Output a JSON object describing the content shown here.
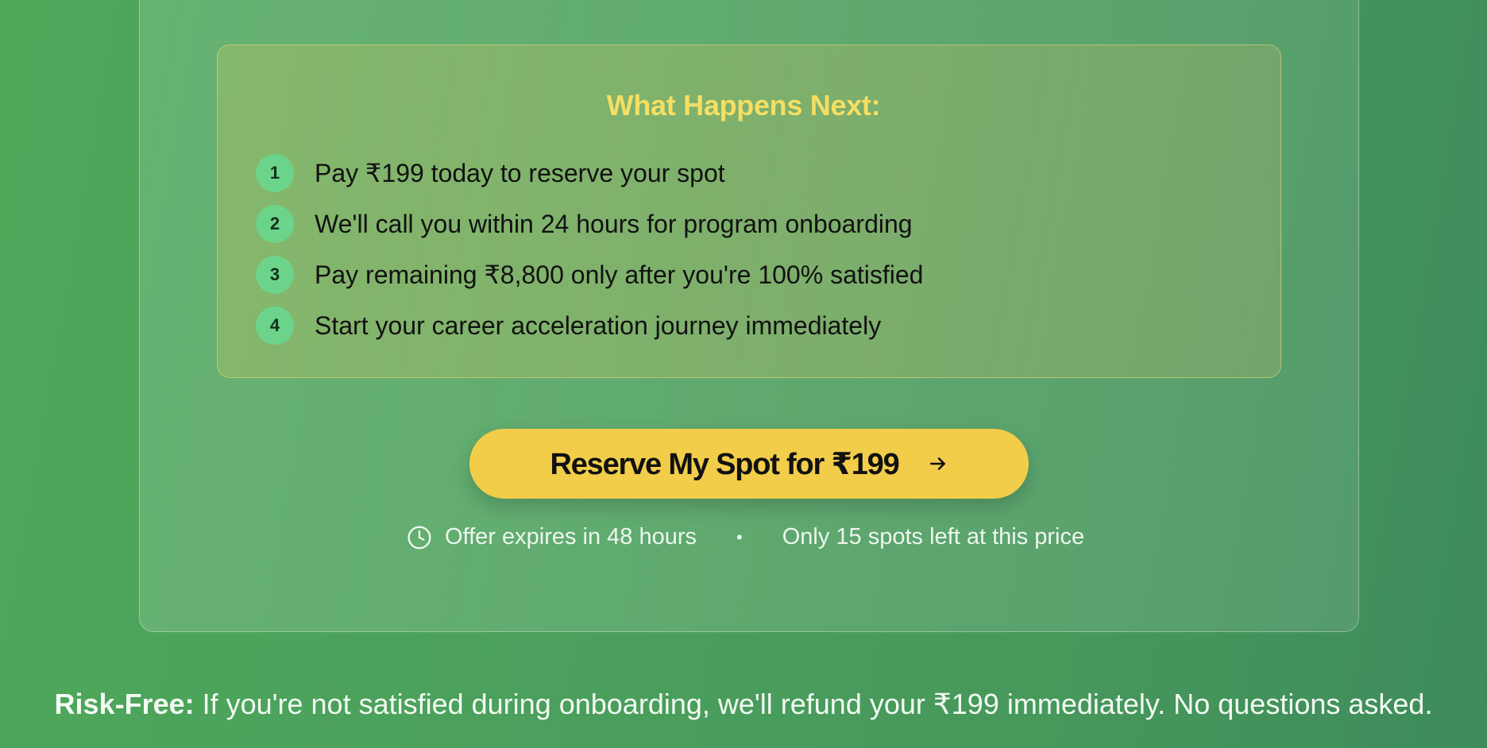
{
  "next": {
    "title": "What Happens Next:",
    "steps": [
      {
        "num": "1",
        "text": "Pay ₹199 today to reserve your spot"
      },
      {
        "num": "2",
        "text": "We'll call you within 24 hours for program onboarding"
      },
      {
        "num": "3",
        "text": "Pay remaining ₹8,800 only after you're 100% satisfied"
      },
      {
        "num": "4",
        "text": "Start your career acceleration journey immediately"
      }
    ]
  },
  "cta": {
    "label": "Reserve My Spot for ₹199"
  },
  "meta": {
    "expiry": "Offer expires in 48 hours",
    "separator": "•",
    "spots": "Only 15 spots left at this price"
  },
  "footer": {
    "label": "Risk-Free:",
    "text": " If you're not satisfied during onboarding, we'll refund your ₹199 immediately. No questions asked."
  },
  "colors": {
    "accent": "#f2cd4a",
    "title": "#f5df63",
    "step_badge": "#6bd48a"
  }
}
